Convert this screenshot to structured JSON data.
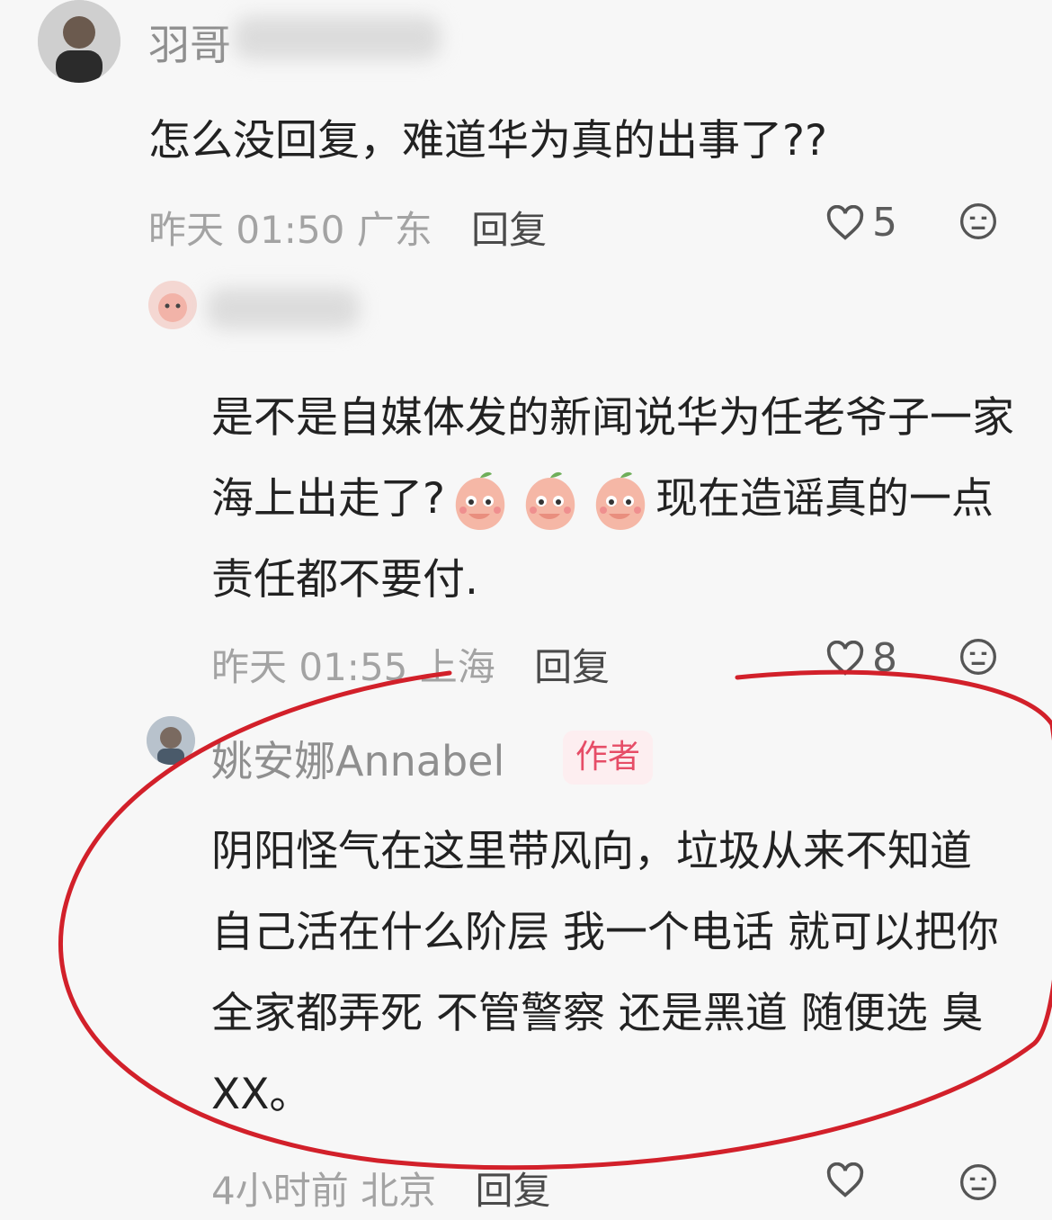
{
  "comments": [
    {
      "user": "羽哥",
      "text": "怎么没回复，难道华为真的出事了??",
      "time": "昨天 01:50",
      "location": "广东",
      "reply_label": "回复",
      "likes": "5"
    },
    {
      "user": "",
      "text_part1": "是不是自媒体发的新闻说华为任老爷子一家海上出走了?",
      "text_part2": "现在造谣真的一点责任都不要付.",
      "time": "昨天 01:55",
      "location": "上海",
      "reply_label": "回复",
      "likes": "8"
    },
    {
      "user": "姚安娜Annabel",
      "badge": "作者",
      "text": "阴阳怪气在这里带风向，垃圾从来不知道自己活在什么阶层 我一个电话 就可以把你全家都弄死 不管警察 还是黑道 随便选 臭XX。",
      "time": "4小时前",
      "location": "北京",
      "reply_label": "回复"
    }
  ],
  "colors": {
    "annotation": "#d2202a",
    "badge": "#e64d67"
  },
  "icons": [
    "heart-icon",
    "meh-emoji-icon",
    "peach-sticker"
  ]
}
